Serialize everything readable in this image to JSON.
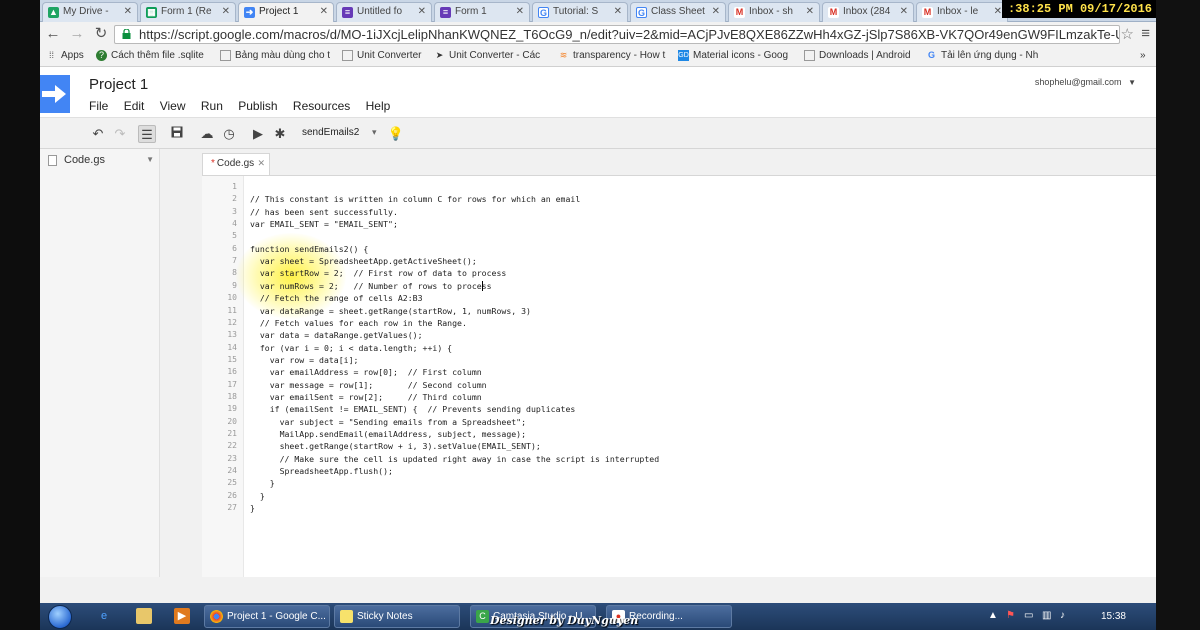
{
  "browser": {
    "tabs": [
      {
        "label": "My Drive -",
        "icon": "drive-icon",
        "color": "#1fa463"
      },
      {
        "label": "Form 1 (Re",
        "icon": "sheets-icon",
        "color": "#0f9d58"
      },
      {
        "label": "Project 1",
        "icon": "apps-script-icon",
        "color": "#4285f4"
      },
      {
        "label": "Untitled fo",
        "icon": "forms-icon",
        "color": "#673ab7"
      },
      {
        "label": "Form 1",
        "icon": "forms-icon",
        "color": "#673ab7"
      },
      {
        "label": "Tutorial: S",
        "icon": "google-icon",
        "color": "#4285f4"
      },
      {
        "label": "Class Sheet",
        "icon": "google-icon",
        "color": "#4285f4"
      },
      {
        "label": "Inbox - sh",
        "icon": "gmail-icon",
        "color": "#d93025"
      },
      {
        "label": "Inbox (284",
        "icon": "gmail-icon",
        "color": "#d93025"
      },
      {
        "label": "Inbox - le",
        "icon": "gmail-icon",
        "color": "#d93025"
      }
    ],
    "clock": ":38:25 PM 09/17/2016",
    "url": "https://script.google.com/macros/d/MO-1iJXcjLelipNhanKWQNEZ_T6OcG9_n/edit?uiv=2&mid=ACjPJvE8QXE86ZZwHh4xGZ-jSlp7S86XB-VK7QOr49enGW9FILmzakTe-UL",
    "bookmarks": [
      {
        "label": "Apps"
      },
      {
        "label": "Cách thêm file .sqlite"
      },
      {
        "label": "Bảng màu dùng cho t"
      },
      {
        "label": "Unit Converter"
      },
      {
        "label": "Unit Converter - Các"
      },
      {
        "label": "transparency - How t"
      },
      {
        "label": "Material icons - Goog"
      },
      {
        "label": "Downloads | Android"
      },
      {
        "label": "Tải lên ứng dụng - Nh"
      }
    ]
  },
  "app": {
    "title": "Project 1",
    "menu": [
      "File",
      "Edit",
      "View",
      "Run",
      "Publish",
      "Resources",
      "Help"
    ],
    "account": "shophelu@gmail.com",
    "function_name": "sendEmails2",
    "brand_color": "#4285f4"
  },
  "sidebar": {
    "file": "Code.gs"
  },
  "editor": {
    "tab_label": "Code.gs",
    "dirty_marker": "*",
    "lines": [
      "",
      "// This constant is written in column C for rows for which an email",
      "// has been sent successfully.",
      "var EMAIL_SENT = \"EMAIL_SENT\";",
      "",
      "function sendEmails2() {",
      "  var sheet = SpreadsheetApp.getActiveSheet();",
      "  var startRow = 2;  // First row of data to process",
      "  var numRows = 2;   // Number of rows to process",
      "  // Fetch the range of cells A2:B3",
      "  var dataRange = sheet.getRange(startRow, 1, numRows, 3)",
      "  // Fetch values for each row in the Range.",
      "  var data = dataRange.getValues();",
      "  for (var i = 0; i < data.length; ++i) {",
      "    var row = data[i];",
      "    var emailAddress = row[0];  // First column",
      "    var message = row[1];       // Second column",
      "    var emailSent = row[2];     // Third column",
      "    if (emailSent != EMAIL_SENT) {  // Prevents sending duplicates",
      "      var subject = \"Sending emails from a Spreadsheet\";",
      "      MailApp.sendEmail(emailAddress, subject, message);",
      "      sheet.getRange(startRow + i, 3).setValue(EMAIL_SENT);",
      "      // Make sure the cell is updated right away in case the script is interrupted",
      "      SpreadsheetApp.flush();",
      "    }",
      "  }",
      "}"
    ]
  },
  "taskbar": {
    "buttons": [
      {
        "label": "Project 1 - Google C...",
        "icon": "chrome-icon"
      },
      {
        "label": "Sticky Notes",
        "icon": "sticky-notes-icon"
      },
      {
        "label": "Camtasia Studio - U...",
        "icon": "camtasia-icon"
      },
      {
        "label": "Recording...",
        "icon": "recording-icon"
      }
    ],
    "time": "15:38"
  },
  "watermark": "Designer by DuyNguyen"
}
